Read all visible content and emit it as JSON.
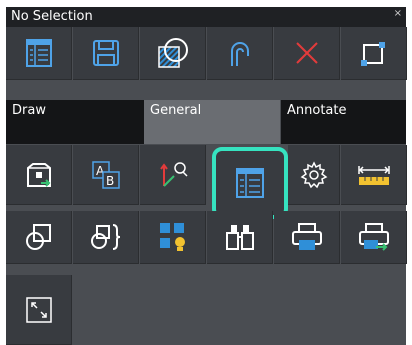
{
  "panel": {
    "title": "No Selection",
    "close_symbol": "×"
  },
  "tabs": [
    {
      "label": "Draw",
      "active": false
    },
    {
      "label": "General",
      "active": true
    },
    {
      "label": "Annotate",
      "active": false
    }
  ],
  "row1_icons": [
    "properties-list-icon",
    "save-icon",
    "hatch-shape-icon",
    "arc-icon",
    "delete-x-icon",
    "rectangle-icon"
  ],
  "row2_icons": [
    "insert-block-icon",
    "text-style-icon",
    "ucs-zoom-icon",
    "properties-palette-icon",
    "settings-gear-icon",
    "measure-ruler-icon"
  ],
  "row3_icons": [
    "region-icon",
    "group-icon",
    "layer-states-icon",
    "find-binoculars-icon",
    "print-icon",
    "print-preview-icon"
  ],
  "row4_icons": [
    "fullscreen-expand-icon"
  ],
  "colors": {
    "highlight": "#36e3c0",
    "accent_blue": "#2f8fd8",
    "accent_red": "#e23b3b",
    "accent_yellow": "#f2c230",
    "accent_green": "#38c172"
  }
}
